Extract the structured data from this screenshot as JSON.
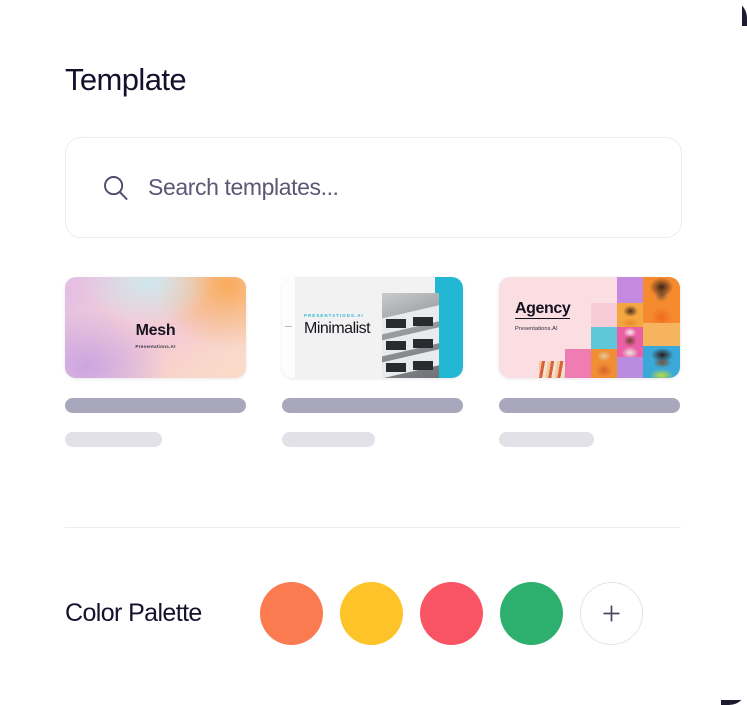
{
  "window": {
    "title": "Template"
  },
  "header": {
    "title": "Template"
  },
  "search": {
    "placeholder": "Search templates...",
    "value": "",
    "icon": "search-icon"
  },
  "templates": {
    "items": [
      {
        "id": "mesh",
        "title": "Mesh",
        "subtitle": "Presentations.AI",
        "style": "gradient-mesh"
      },
      {
        "id": "minimalist",
        "kicker": "PRESENTATIONS.AI",
        "title": "Minimalist",
        "accent_color": "#22b8d4",
        "style": "minimal-photo"
      },
      {
        "id": "agency",
        "title": "Agency",
        "subtitle": "Presentations.AI",
        "background_color": "#fadee2",
        "style": "photo-collage"
      }
    ]
  },
  "palette": {
    "label": "Color Palette",
    "swatches": [
      {
        "name": "orange",
        "color": "#f97b4f"
      },
      {
        "name": "yellow",
        "color": "#fdc328"
      },
      {
        "name": "red",
        "color": "#f95463"
      },
      {
        "name": "green",
        "color": "#2db06e"
      }
    ],
    "add_label": "+",
    "add_icon": "plus-icon"
  },
  "colors": {
    "title_text": "#13112b",
    "placeholder_text": "#5a5875",
    "border": "#ececf0",
    "divider": "#eeeef1",
    "skeleton_dark": "#a9a7bb",
    "skeleton_light": "#e2e1e7",
    "background": "#ffffff"
  }
}
